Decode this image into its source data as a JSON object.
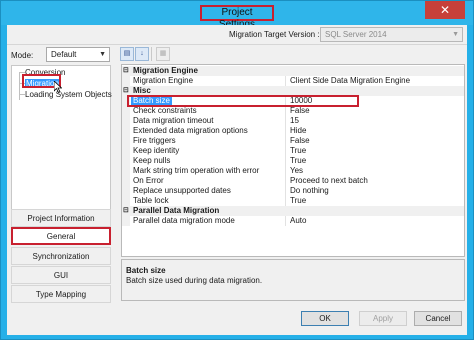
{
  "window": {
    "title": "Project Settings",
    "close_glyph": "✕"
  },
  "header": {
    "target_label": "Migration Target Version :",
    "target_value": "SQL Server 2014"
  },
  "left": {
    "mode_label": "Mode:",
    "mode_value": "Default",
    "tree": [
      "Conversion",
      "Migration",
      "Loading System Objects"
    ],
    "nav": [
      "Project Information",
      "General",
      "Synchronization",
      "GUI",
      "Type Mapping"
    ]
  },
  "grid": {
    "rows": [
      {
        "type": "cat",
        "name": "Migration Engine"
      },
      {
        "type": "prop",
        "name": "Migration Engine",
        "value": "Client Side Data Migration Engine"
      },
      {
        "type": "cat",
        "name": "Misc"
      },
      {
        "type": "prop",
        "name": "Batch size",
        "value": "10000"
      },
      {
        "type": "prop",
        "name": "Check constraints",
        "value": "False"
      },
      {
        "type": "prop",
        "name": "Data migration timeout",
        "value": "15"
      },
      {
        "type": "prop",
        "name": "Extended data migration options",
        "value": "Hide"
      },
      {
        "type": "prop",
        "name": "Fire triggers",
        "value": "False"
      },
      {
        "type": "prop",
        "name": "Keep identity",
        "value": "True"
      },
      {
        "type": "prop",
        "name": "Keep nulls",
        "value": "True"
      },
      {
        "type": "prop",
        "name": "Mark string trim operation with error",
        "value": "Yes"
      },
      {
        "type": "prop",
        "name": "On Error",
        "value": "Proceed to next batch"
      },
      {
        "type": "prop",
        "name": "Replace unsupported dates",
        "value": "Do nothing"
      },
      {
        "type": "prop",
        "name": "Table lock",
        "value": "True"
      },
      {
        "type": "cat",
        "name": "Parallel Data Migration"
      },
      {
        "type": "prop",
        "name": "Parallel data migration mode",
        "value": "Auto"
      }
    ]
  },
  "description": {
    "title": "Batch size",
    "text": "Batch size used during data migration."
  },
  "buttons": {
    "ok": "OK",
    "apply": "Apply",
    "cancel": "Cancel"
  },
  "colors": {
    "titlebar": "#2fb5ea",
    "highlight": "#c8202f",
    "selection": "#3399ff",
    "close": "#c7403a"
  },
  "icons": [
    "close-icon",
    "categorized-icon",
    "alphabetical-icon",
    "property-pages-icon",
    "dropdown-arrow-icon",
    "mouse-cursor-icon"
  ]
}
